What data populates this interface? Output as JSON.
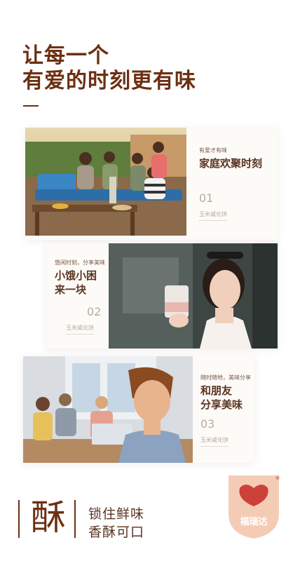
{
  "headline": {
    "line1": "让每一个",
    "line2": "有爱的时刻更有味"
  },
  "cards": [
    {
      "kicker": "有爱才有味",
      "title1": "家庭欢聚时刻",
      "title2": "",
      "number": "01",
      "product": "玉米威化饼"
    },
    {
      "kicker": "悠闲时刻，分享美味",
      "title1": "小饿小困",
      "title2": "来一块",
      "number": "02",
      "product": "玉米威化饼"
    },
    {
      "kicker": "随时随地，美味分享",
      "title1": "和朋友",
      "title2": "分享美味",
      "number": "03",
      "product": "玉米威化饼"
    }
  ],
  "bottom": {
    "char": "酥",
    "line1": "锁住鲜味",
    "line2": "香酥可口"
  },
  "logo": {
    "text": "福瑞达",
    "mark": "®"
  },
  "colors": {
    "brand": "#6d2f12",
    "logo_bg": "#f2c3a8",
    "logo_accent": "#c8332e"
  }
}
